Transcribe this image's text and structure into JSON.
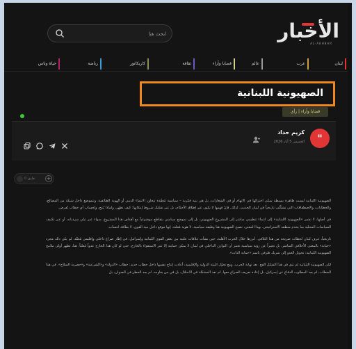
{
  "header": {
    "logo_text": "الأخبار",
    "logo_sub": "AL-AKHBAR",
    "search_placeholder": "ابحث هنا"
  },
  "nav": {
    "items": [
      {
        "label": "لبنان",
        "color": "#e23636"
      },
      {
        "label": "عرب",
        "color": "#c9a33a"
      },
      {
        "label": "عالم",
        "color": "#9a9a9a"
      },
      {
        "label": "قضايا وآراء",
        "color": "#d7d08a"
      },
      {
        "label": "ثقافة",
        "color": "#6f57c8"
      },
      {
        "label": "كاريكاتور",
        "color": "#8e8e5a"
      },
      {
        "label": "رياضة",
        "color": "#3a9fd8"
      },
      {
        "label": "حياة وناس",
        "color": "#b81f6b"
      }
    ]
  },
  "article": {
    "headline": "الصهيونية اللبنانية",
    "category": "قضايا وآراء | رأي",
    "author": {
      "name": "كريم حداد",
      "date": "الخميس 5 أيار 2026"
    },
    "comments_label": "0 تعليق",
    "paragraphs": [
      "الصهيونية اللبنانية ليست ظاهرة بسيطة يمكن اختزالها في الاتهام أو في الشعارات، بل هي بنية فكرية – سياسية مُعقّدة تتجاوز الانتماء الديني أو الهوية الطائفية، وتتموضع داخل شبكة من المصالح، والخطابات، والاصطفافات التي تشكّلت تاريخياً في لبنان الحديث. لذلك، فإنّ فهمها لا يكون عبر إطلاق الأحكام، بل عبر تفكيك شروط إمكانها: كيف تظهر، ولماذا تُنتج، ولحساب أي خطاب تُفرض.",
      "في أصلها، لا تشير «الصهيونية اللبنانية» إلى انتماء تنظيمي مباشر إلى المشروع الصهيوني، بل إلى تموضع سياسي يتقاطع موضوعياً مع أهداف هذا المشروع، سواء عبر تبنّي سردياته، أو عبر تكييف السياسات المحلية بما يخدم منطقه الاستراتيجي. بهذا المعنى، تصبح الصهيونية هنا وظيفة سياسية، لا هوية مُعلنة، إنها موقع داخل بنية القوى، لا بطاقة انتساب.",
      "تاريخياً، عرف لبنان لحظات صريحة من هذا التلاقي. أبرزها خلال الحرب الأهلية، حين نشأت علاقات علنية بين بعض القوى اللبنانية وإسرائيل، في إطار صراع داخلي وإقليمي مُعقّد. لم يكن ذلك مجرد «خيانة» بالمعنى الأخلاقي المباشر، بل تعبيراً عن رؤية سياسية تعتبر أن التوازن الداخلي في لبنان لا يمكن حمايته إلا عبر الاستقواء بالخارج، حتى لو كان هذا الخارج عدواً مُعلناً. هنا، تظهر أولى ملامح الصهيونية اللبنانية: تحويل العدو إلى شريك ظرفي باسم «حماية الذات».",
      "لكن الصهيونية اللبنانية لم تبق في هذا الشكل الفج. بعد نهاية الحرب، ومع تحوّل البيئة الدولية والإقليمية، أعادت إنتاج نفسها داخل خطاب جديد: خطاب «الدولة» و«الشرعية» و«حصرية السلاح». في هذا الخطاب، لم يعد المطلوب الدفاع عن إسرائيل، بل إعادة تعريف الصراع معها. لم تعد المشكلة في الاحتلال، بل في من يقاومه. لم يعد الخطر في العدوان، بل"
    ]
  }
}
